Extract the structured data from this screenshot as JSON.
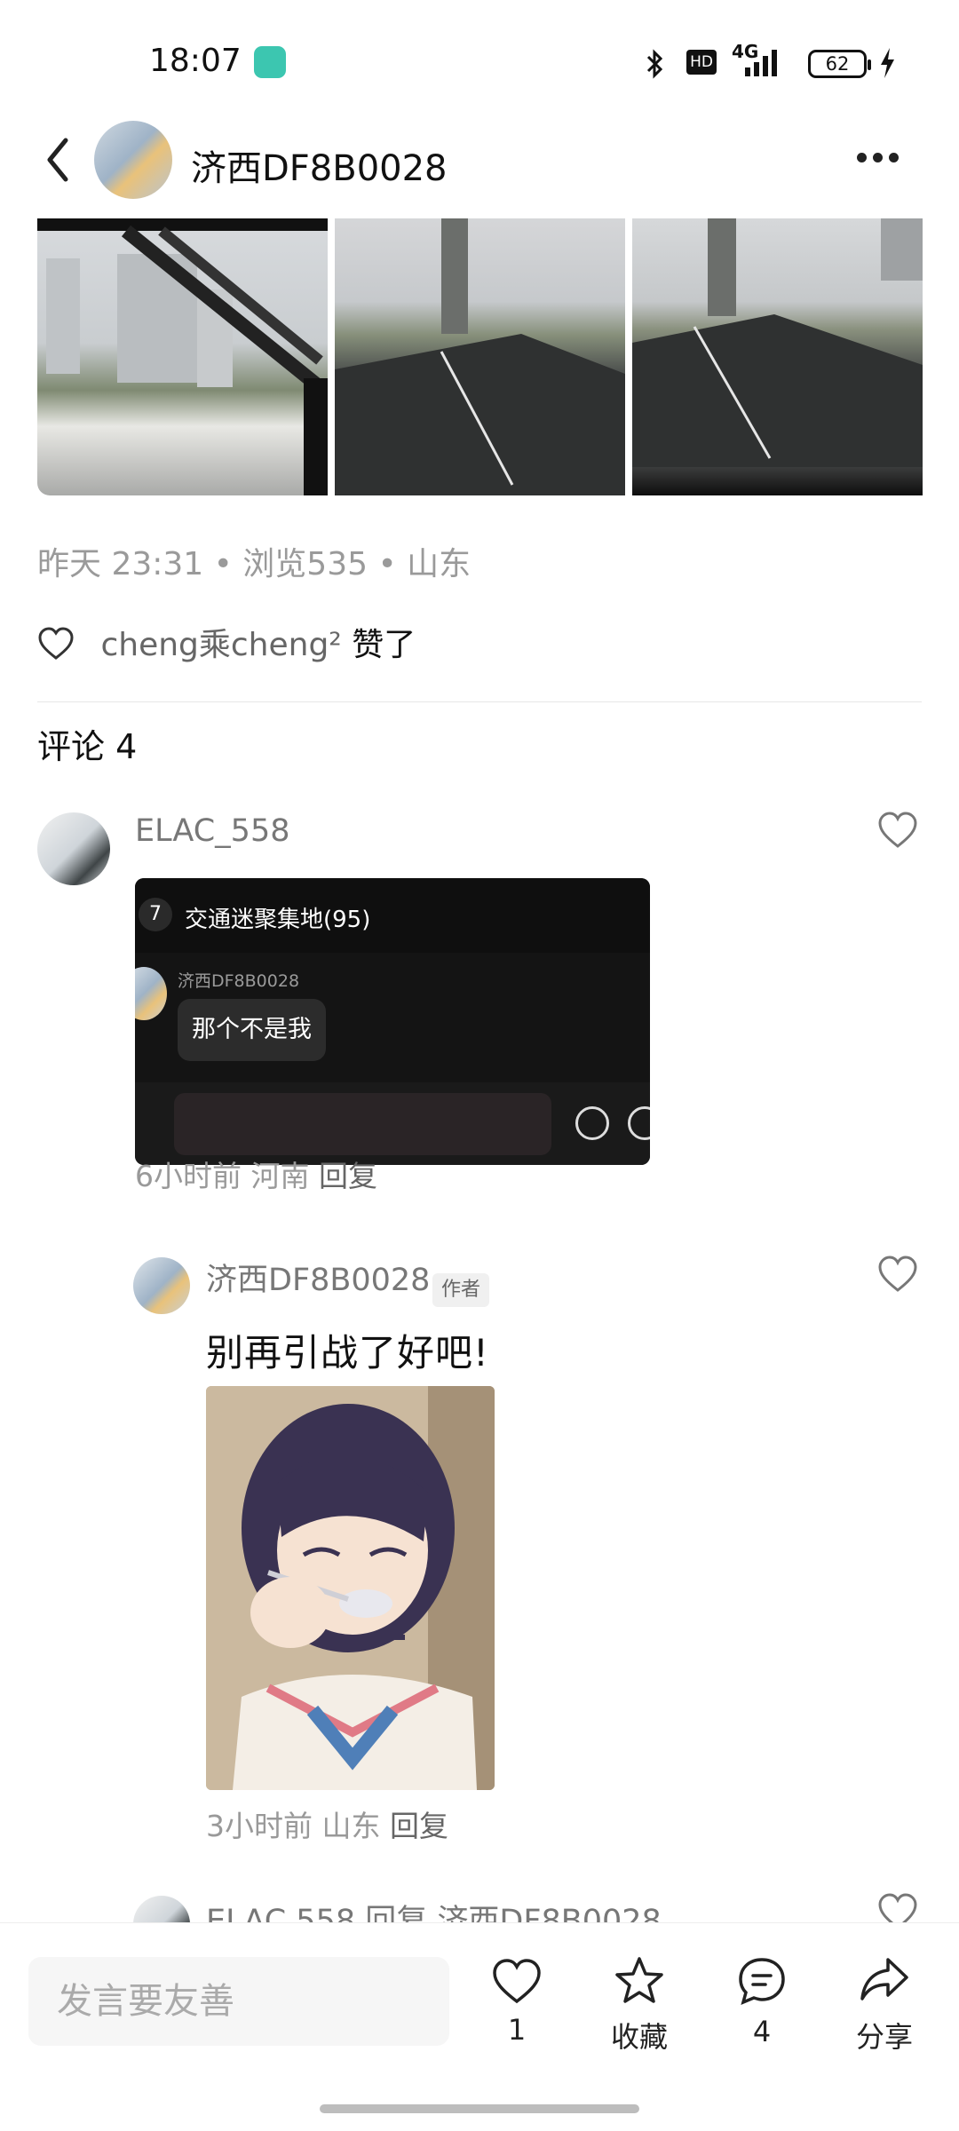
{
  "status_bar": {
    "time": "18:07",
    "network": "4G",
    "hd": "HD",
    "battery": "62"
  },
  "header": {
    "title": "济西DF8B0028"
  },
  "post": {
    "meta": "昨天 23:31 • 浏览535 • 山东",
    "liked_by_user": "cheng乘cheng²",
    "liked_suffix": "赞了"
  },
  "comments": {
    "heading": "评论 4",
    "items": [
      {
        "username": "ELAC_558",
        "image": {
          "group_badge": "7",
          "group_name": "交通迷聚集地(95)",
          "sender": "济西DF8B0028",
          "message": "那个不是我"
        },
        "time_loc": "6小时前 河南",
        "reply_label": "回复"
      },
      {
        "username": "济西DF8B0028",
        "badge": "作者",
        "text": "别再引战了好吧!",
        "time_loc": "3小时前 山东",
        "reply_label": "回复"
      },
      {
        "username_partial": "ELAC 558 回复 济西DF8B0028"
      }
    ]
  },
  "bottom_bar": {
    "input_placeholder": "发言要友善",
    "like_count": "1",
    "collect_label": "收藏",
    "comment_count": "4",
    "share_label": "分享"
  }
}
